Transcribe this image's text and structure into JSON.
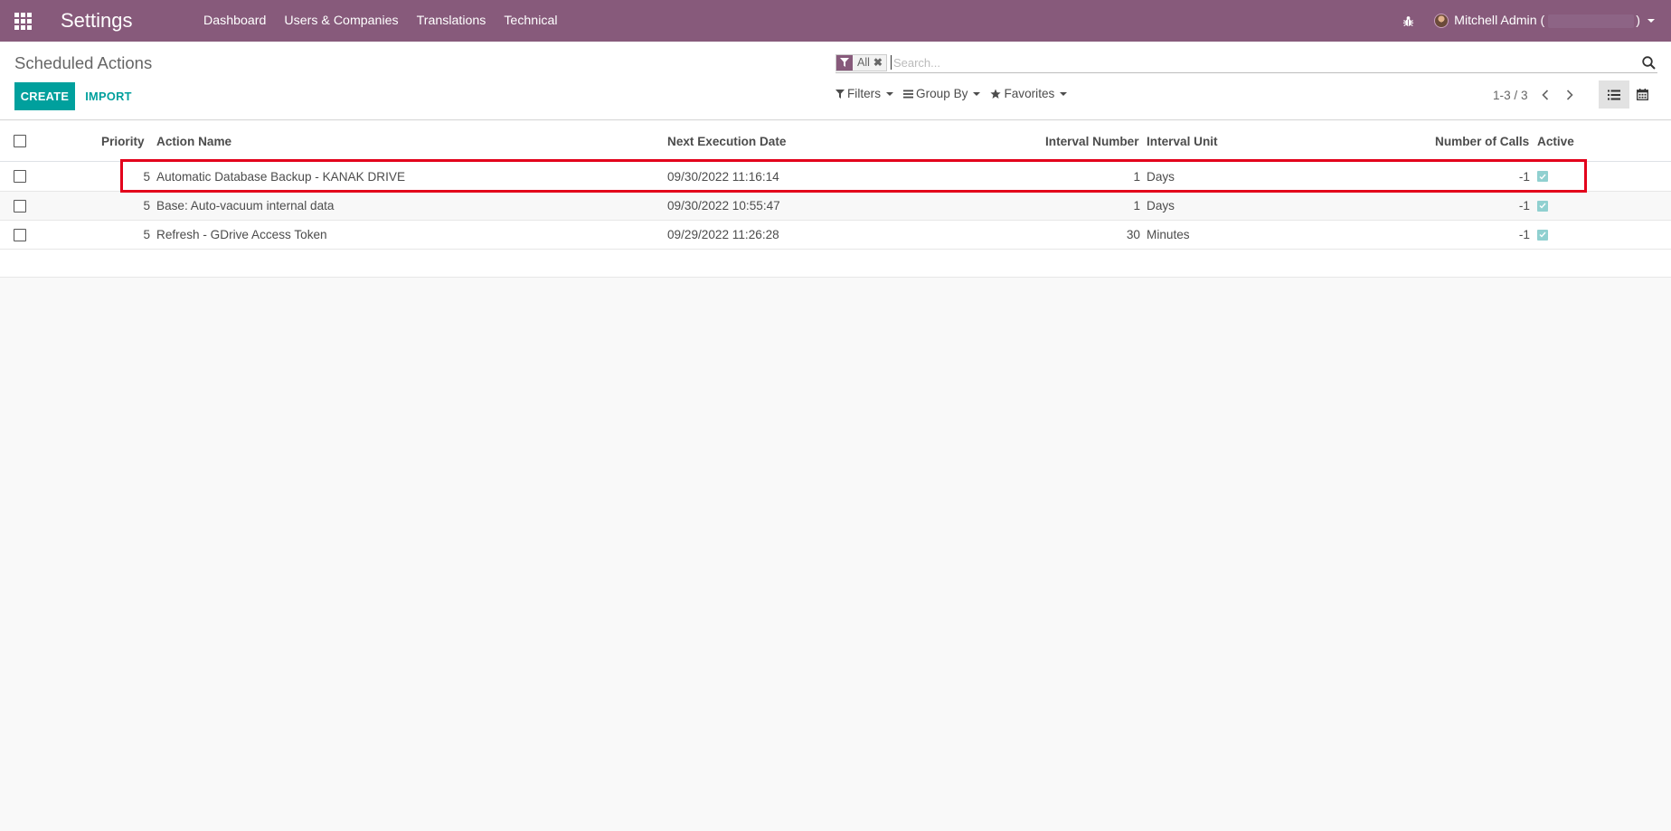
{
  "navbar": {
    "app_name": "Settings",
    "menu": [
      {
        "label": "Dashboard"
      },
      {
        "label": "Users & Companies"
      },
      {
        "label": "Translations"
      },
      {
        "label": "Technical"
      }
    ],
    "user_name": "Mitchell Admin (",
    "user_suffix": ")"
  },
  "control_panel": {
    "breadcrumb": "Scheduled Actions",
    "create_label": "CREATE",
    "import_label": "IMPORT",
    "search": {
      "facet_label": "All",
      "placeholder": "Search..."
    },
    "filters_label": "Filters",
    "group_by_label": "Group By",
    "favorites_label": "Favorites",
    "pager": "1-3 / 3"
  },
  "table": {
    "headers": {
      "priority": "Priority",
      "action_name": "Action Name",
      "next_execution_date": "Next Execution Date",
      "interval_number": "Interval Number",
      "interval_unit": "Interval Unit",
      "number_of_calls": "Number of Calls",
      "active": "Active"
    },
    "rows": [
      {
        "priority": "5",
        "action_name": "Automatic Database Backup - KANAK DRIVE",
        "next_execution_date": "09/30/2022 11:16:14",
        "interval_number": "1",
        "interval_unit": "Days",
        "number_of_calls": "-1",
        "active": true
      },
      {
        "priority": "5",
        "action_name": "Base: Auto-vacuum internal data",
        "next_execution_date": "09/30/2022 10:55:47",
        "interval_number": "1",
        "interval_unit": "Days",
        "number_of_calls": "-1",
        "active": true
      },
      {
        "priority": "5",
        "action_name": "Refresh - GDrive Access Token",
        "next_execution_date": "09/29/2022 11:26:28",
        "interval_number": "30",
        "interval_unit": "Minutes",
        "number_of_calls": "-1",
        "active": true
      }
    ]
  },
  "colors": {
    "brand": "#875a7b",
    "accent": "#00a09d",
    "highlight": "#e3001b"
  }
}
